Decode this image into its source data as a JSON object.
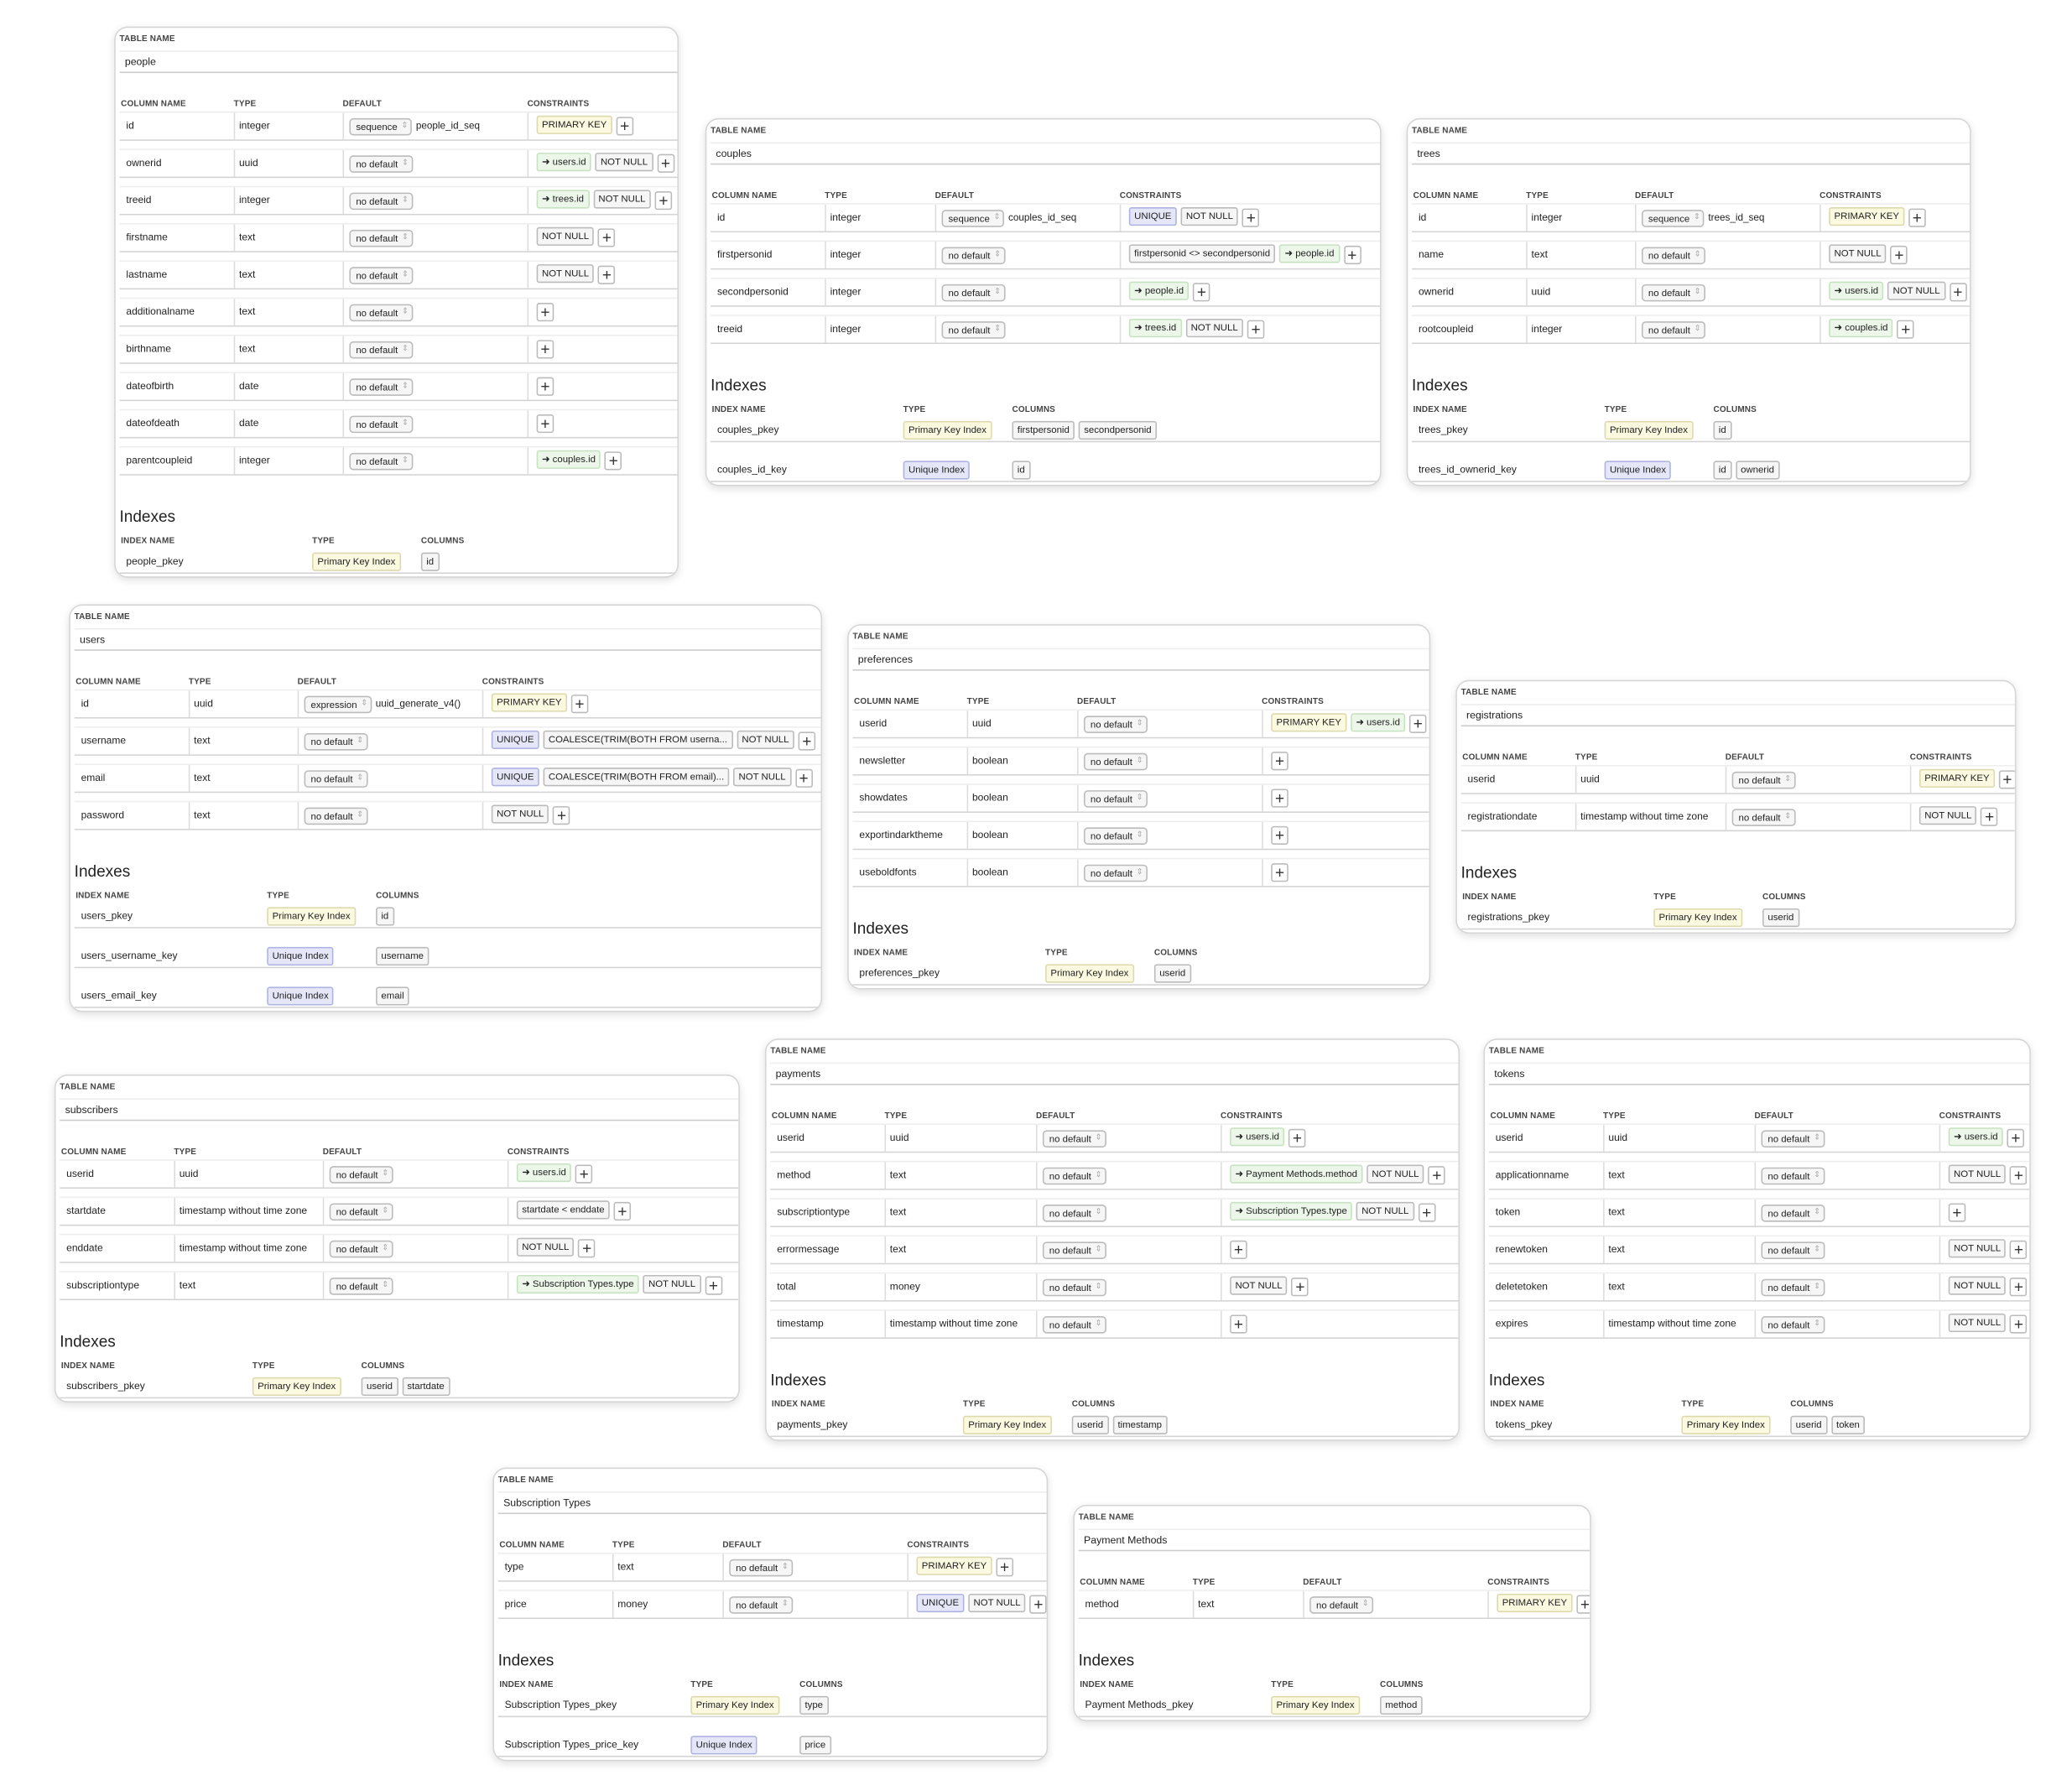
{
  "labels": {
    "table_name": "TABLE NAME",
    "column_name": "COLUMN NAME",
    "type": "TYPE",
    "default": "DEFAULT",
    "constraints": "CONSTRAINTS",
    "indexes": "Indexes",
    "index_name": "INDEX NAME",
    "index_type": "TYPE",
    "columns": "COLUMNS",
    "add": "+"
  },
  "colors": {
    "primary_key": "#fbf9df",
    "foreign_key": "#ecf7ea",
    "unique": "#e5e7f8",
    "plain": "#f6f6f6"
  },
  "tables": [
    {
      "name": "people",
      "columns": [
        {
          "name": "id",
          "type": "integer",
          "default": "sequence",
          "default_value": "people_id_seq",
          "constraints": [
            {
              "kind": "pk",
              "text": "PRIMARY KEY"
            }
          ]
        },
        {
          "name": "ownerid",
          "type": "uuid",
          "default": "no default",
          "constraints": [
            {
              "kind": "fk",
              "text": "➜ users.id"
            },
            {
              "kind": "plain",
              "text": "NOT NULL"
            }
          ]
        },
        {
          "name": "treeid",
          "type": "integer",
          "default": "no default",
          "constraints": [
            {
              "kind": "fk",
              "text": "➜ trees.id"
            },
            {
              "kind": "plain",
              "text": "NOT NULL"
            }
          ]
        },
        {
          "name": "firstname",
          "type": "text",
          "default": "no default",
          "constraints": [
            {
              "kind": "plain",
              "text": "NOT NULL"
            }
          ]
        },
        {
          "name": "lastname",
          "type": "text",
          "default": "no default",
          "constraints": [
            {
              "kind": "plain",
              "text": "NOT NULL"
            }
          ]
        },
        {
          "name": "additionalname",
          "type": "text",
          "default": "no default",
          "constraints": []
        },
        {
          "name": "birthname",
          "type": "text",
          "default": "no default",
          "constraints": []
        },
        {
          "name": "dateofbirth",
          "type": "date",
          "default": "no default",
          "constraints": []
        },
        {
          "name": "dateofdeath",
          "type": "date",
          "default": "no default",
          "constraints": []
        },
        {
          "name": "parentcoupleid",
          "type": "integer",
          "default": "no default",
          "constraints": [
            {
              "kind": "fk",
              "text": "➜ couples.id"
            }
          ]
        }
      ],
      "indexes": [
        {
          "name": "people_pkey",
          "type": "Primary Key Index",
          "kind": "pk",
          "columns": [
            "id"
          ]
        }
      ]
    },
    {
      "name": "couples",
      "columns": [
        {
          "name": "id",
          "type": "integer",
          "default": "sequence",
          "default_value": "couples_id_seq",
          "constraints": [
            {
              "kind": "uq",
              "text": "UNIQUE"
            },
            {
              "kind": "plain",
              "text": "NOT NULL"
            }
          ]
        },
        {
          "name": "firstpersonid",
          "type": "integer",
          "default": "no default",
          "constraints": [
            {
              "kind": "plain",
              "text": "firstpersonid <> secondpersonid"
            },
            {
              "kind": "fk",
              "text": "➜ people.id"
            }
          ]
        },
        {
          "name": "secondpersonid",
          "type": "integer",
          "default": "no default",
          "constraints": [
            {
              "kind": "fk",
              "text": "➜ people.id"
            }
          ]
        },
        {
          "name": "treeid",
          "type": "integer",
          "default": "no default",
          "constraints": [
            {
              "kind": "fk",
              "text": "➜ trees.id"
            },
            {
              "kind": "plain",
              "text": "NOT NULL"
            }
          ]
        }
      ],
      "indexes": [
        {
          "name": "couples_pkey",
          "type": "Primary Key Index",
          "kind": "pk",
          "columns": [
            "firstpersonid",
            "secondpersonid"
          ]
        },
        {
          "name": "couples_id_key",
          "type": "Unique Index",
          "kind": "uq",
          "columns": [
            "id"
          ]
        }
      ]
    },
    {
      "name": "trees",
      "columns": [
        {
          "name": "id",
          "type": "integer",
          "default": "sequence",
          "default_value": "trees_id_seq",
          "constraints": [
            {
              "kind": "pk",
              "text": "PRIMARY KEY"
            }
          ]
        },
        {
          "name": "name",
          "type": "text",
          "default": "no default",
          "constraints": [
            {
              "kind": "plain",
              "text": "NOT NULL"
            }
          ]
        },
        {
          "name": "ownerid",
          "type": "uuid",
          "default": "no default",
          "constraints": [
            {
              "kind": "fk",
              "text": "➜ users.id"
            },
            {
              "kind": "plain",
              "text": "NOT NULL"
            }
          ]
        },
        {
          "name": "rootcoupleid",
          "type": "integer",
          "default": "no default",
          "constraints": [
            {
              "kind": "fk",
              "text": "➜ couples.id"
            }
          ]
        }
      ],
      "indexes": [
        {
          "name": "trees_pkey",
          "type": "Primary Key Index",
          "kind": "pk",
          "columns": [
            "id"
          ]
        },
        {
          "name": "trees_id_ownerid_key",
          "type": "Unique Index",
          "kind": "uq",
          "columns": [
            "id",
            "ownerid"
          ]
        }
      ]
    },
    {
      "name": "users",
      "columns": [
        {
          "name": "id",
          "type": "uuid",
          "default": "expression",
          "default_value": "uuid_generate_v4()",
          "constraints": [
            {
              "kind": "pk",
              "text": "PRIMARY KEY"
            }
          ]
        },
        {
          "name": "username",
          "type": "text",
          "default": "no default",
          "constraints": [
            {
              "kind": "uq",
              "text": "UNIQUE"
            },
            {
              "kind": "plain",
              "text": "COALESCE(TRIM(BOTH FROM userna..."
            },
            {
              "kind": "plain",
              "text": "NOT NULL"
            }
          ]
        },
        {
          "name": "email",
          "type": "text",
          "default": "no default",
          "constraints": [
            {
              "kind": "uq",
              "text": "UNIQUE"
            },
            {
              "kind": "plain",
              "text": "COALESCE(TRIM(BOTH FROM email)..."
            },
            {
              "kind": "plain",
              "text": "NOT NULL"
            }
          ]
        },
        {
          "name": "password",
          "type": "text",
          "default": "no default",
          "constraints": [
            {
              "kind": "plain",
              "text": "NOT NULL"
            }
          ]
        }
      ],
      "indexes": [
        {
          "name": "users_pkey",
          "type": "Primary Key Index",
          "kind": "pk",
          "columns": [
            "id"
          ]
        },
        {
          "name": "users_username_key",
          "type": "Unique Index",
          "kind": "uq",
          "columns": [
            "username"
          ]
        },
        {
          "name": "users_email_key",
          "type": "Unique Index",
          "kind": "uq",
          "columns": [
            "email"
          ]
        }
      ]
    },
    {
      "name": "preferences",
      "columns": [
        {
          "name": "userid",
          "type": "uuid",
          "default": "no default",
          "constraints": [
            {
              "kind": "pk",
              "text": "PRIMARY KEY"
            },
            {
              "kind": "fk",
              "text": "➜ users.id"
            }
          ]
        },
        {
          "name": "newsletter",
          "type": "boolean",
          "default": "no default",
          "constraints": []
        },
        {
          "name": "showdates",
          "type": "boolean",
          "default": "no default",
          "constraints": []
        },
        {
          "name": "exportindarktheme",
          "type": "boolean",
          "default": "no default",
          "constraints": []
        },
        {
          "name": "useboldfonts",
          "type": "boolean",
          "default": "no default",
          "constraints": []
        }
      ],
      "indexes": [
        {
          "name": "preferences_pkey",
          "type": "Primary Key Index",
          "kind": "pk",
          "columns": [
            "userid"
          ]
        }
      ]
    },
    {
      "name": "registrations",
      "columns": [
        {
          "name": "userid",
          "type": "uuid",
          "default": "no default",
          "constraints": [
            {
              "kind": "pk",
              "text": "PRIMARY KEY"
            }
          ]
        },
        {
          "name": "registrationdate",
          "type": "timestamp without time zone",
          "default": "no default",
          "constraints": [
            {
              "kind": "plain",
              "text": "NOT NULL"
            }
          ]
        }
      ],
      "indexes": [
        {
          "name": "registrations_pkey",
          "type": "Primary Key Index",
          "kind": "pk",
          "columns": [
            "userid"
          ]
        }
      ]
    },
    {
      "name": "subscribers",
      "columns": [
        {
          "name": "userid",
          "type": "uuid",
          "default": "no default",
          "constraints": [
            {
              "kind": "fk",
              "text": "➜ users.id"
            }
          ]
        },
        {
          "name": "startdate",
          "type": "timestamp without time zone",
          "default": "no default",
          "constraints": [
            {
              "kind": "plain",
              "text": "startdate < enddate"
            }
          ]
        },
        {
          "name": "enddate",
          "type": "timestamp without time zone",
          "default": "no default",
          "constraints": [
            {
              "kind": "plain",
              "text": "NOT NULL"
            }
          ]
        },
        {
          "name": "subscriptiontype",
          "type": "text",
          "default": "no default",
          "constraints": [
            {
              "kind": "fk",
              "text": "➜ Subscription Types.type"
            },
            {
              "kind": "plain",
              "text": "NOT NULL"
            }
          ]
        }
      ],
      "indexes": [
        {
          "name": "subscribers_pkey",
          "type": "Primary Key Index",
          "kind": "pk",
          "columns": [
            "userid",
            "startdate"
          ]
        }
      ]
    },
    {
      "name": "payments",
      "columns": [
        {
          "name": "userid",
          "type": "uuid",
          "default": "no default",
          "constraints": [
            {
              "kind": "fk",
              "text": "➜ users.id"
            }
          ]
        },
        {
          "name": "method",
          "type": "text",
          "default": "no default",
          "constraints": [
            {
              "kind": "fk",
              "text": "➜ Payment Methods.method"
            },
            {
              "kind": "plain",
              "text": "NOT NULL"
            }
          ]
        },
        {
          "name": "subscriptiontype",
          "type": "text",
          "default": "no default",
          "constraints": [
            {
              "kind": "fk",
              "text": "➜ Subscription Types.type"
            },
            {
              "kind": "plain",
              "text": "NOT NULL"
            }
          ]
        },
        {
          "name": "errormessage",
          "type": "text",
          "default": "no default",
          "constraints": []
        },
        {
          "name": "total",
          "type": "money",
          "default": "no default",
          "constraints": [
            {
              "kind": "plain",
              "text": "NOT NULL"
            }
          ]
        },
        {
          "name": "timestamp",
          "type": "timestamp without time zone",
          "default": "no default",
          "constraints": []
        }
      ],
      "indexes": [
        {
          "name": "payments_pkey",
          "type": "Primary Key Index",
          "kind": "pk",
          "columns": [
            "userid",
            "timestamp"
          ]
        }
      ]
    },
    {
      "name": "tokens",
      "columns": [
        {
          "name": "userid",
          "type": "uuid",
          "default": "no default",
          "constraints": [
            {
              "kind": "fk",
              "text": "➜ users.id"
            }
          ]
        },
        {
          "name": "applicationname",
          "type": "text",
          "default": "no default",
          "constraints": [
            {
              "kind": "plain",
              "text": "NOT NULL"
            }
          ]
        },
        {
          "name": "token",
          "type": "text",
          "default": "no default",
          "constraints": []
        },
        {
          "name": "renewtoken",
          "type": "text",
          "default": "no default",
          "constraints": [
            {
              "kind": "plain",
              "text": "NOT NULL"
            }
          ]
        },
        {
          "name": "deletetoken",
          "type": "text",
          "default": "no default",
          "constraints": [
            {
              "kind": "plain",
              "text": "NOT NULL"
            }
          ]
        },
        {
          "name": "expires",
          "type": "timestamp without time zone",
          "default": "no default",
          "constraints": [
            {
              "kind": "plain",
              "text": "NOT NULL"
            }
          ]
        }
      ],
      "indexes": [
        {
          "name": "tokens_pkey",
          "type": "Primary Key Index",
          "kind": "pk",
          "columns": [
            "userid",
            "token"
          ]
        }
      ]
    },
    {
      "name": "Subscription Types",
      "columns": [
        {
          "name": "type",
          "type": "text",
          "default": "no default",
          "constraints": [
            {
              "kind": "pk",
              "text": "PRIMARY KEY"
            }
          ]
        },
        {
          "name": "price",
          "type": "money",
          "default": "no default",
          "constraints": [
            {
              "kind": "uq",
              "text": "UNIQUE"
            },
            {
              "kind": "plain",
              "text": "NOT NULL"
            }
          ]
        }
      ],
      "indexes": [
        {
          "name": "Subscription Types_pkey",
          "type": "Primary Key Index",
          "kind": "pk",
          "columns": [
            "type"
          ]
        },
        {
          "name": "Subscription Types_price_key",
          "type": "Unique Index",
          "kind": "uq",
          "columns": [
            "price"
          ]
        }
      ]
    },
    {
      "name": "Payment Methods",
      "columns": [
        {
          "name": "method",
          "type": "text",
          "default": "no default",
          "constraints": [
            {
              "kind": "pk",
              "text": "PRIMARY KEY"
            }
          ]
        }
      ],
      "indexes": [
        {
          "name": "Payment Methods_pkey",
          "type": "Primary Key Index",
          "kind": "pk",
          "columns": [
            "method"
          ]
        }
      ]
    }
  ]
}
